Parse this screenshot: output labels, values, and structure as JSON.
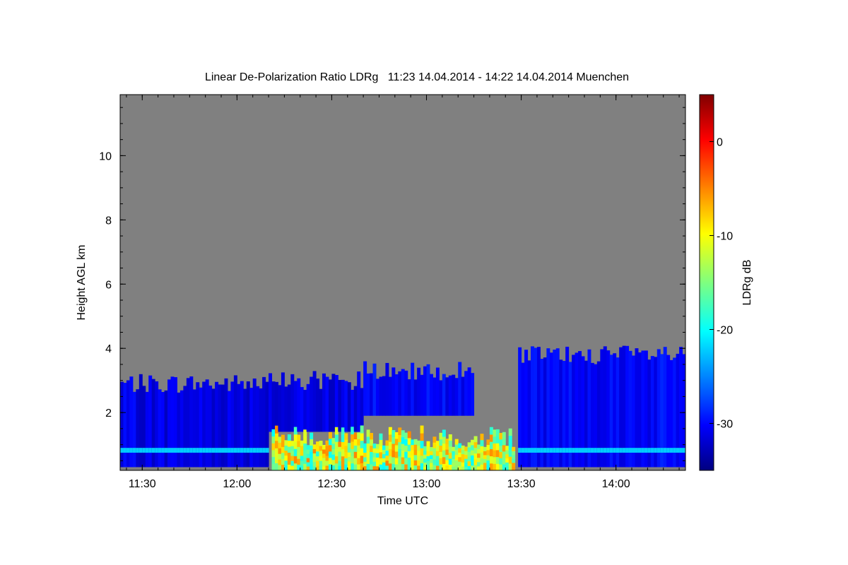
{
  "chart_data": {
    "type": "heatmap",
    "title": "Linear De-Polarization Ratio LDRg   11:23 14.04.2014 - 14:22 14.04.2014 Muenchen",
    "xlabel": "Time UTC",
    "ylabel": "Height AGL km",
    "colorbar_label": "LDRg dB",
    "x_ticks": [
      "11:30",
      "12:00",
      "12:30",
      "13:00",
      "13:30",
      "14:00"
    ],
    "x_tick_minutes": [
      690,
      720,
      750,
      780,
      810,
      840
    ],
    "xlim_minutes": [
      683,
      862
    ],
    "y_ticks": [
      2,
      4,
      6,
      8,
      10
    ],
    "ylim": [
      0.2,
      11.9
    ],
    "colorbar_ticks": [
      0,
      -10,
      -20,
      -30
    ],
    "colorbar_range": [
      -35,
      5
    ],
    "background_color": "#808080",
    "colormap": "jet",
    "cloud_regions": [
      {
        "start": 683,
        "end": 730,
        "base_km": 0.3,
        "top_km": 2.9,
        "ldr_db": -31
      },
      {
        "start": 730,
        "end": 760,
        "base_km": 1.4,
        "top_km": 3.0,
        "ldr_db": -31
      },
      {
        "start": 760,
        "end": 795,
        "base_km": 1.9,
        "top_km": 3.3,
        "ldr_db": -30
      },
      {
        "start": 809,
        "end": 862,
        "base_km": 0.3,
        "top_km": 3.8,
        "ldr_db": -30
      }
    ],
    "melting_layer": {
      "height_km": 0.8,
      "ldr_db": -22
    },
    "precipitation_region": {
      "start": 731,
      "end": 808,
      "base_km": 0.2,
      "top_km": 1.6,
      "ldr_db_range": [
        -20,
        -5
      ]
    }
  }
}
